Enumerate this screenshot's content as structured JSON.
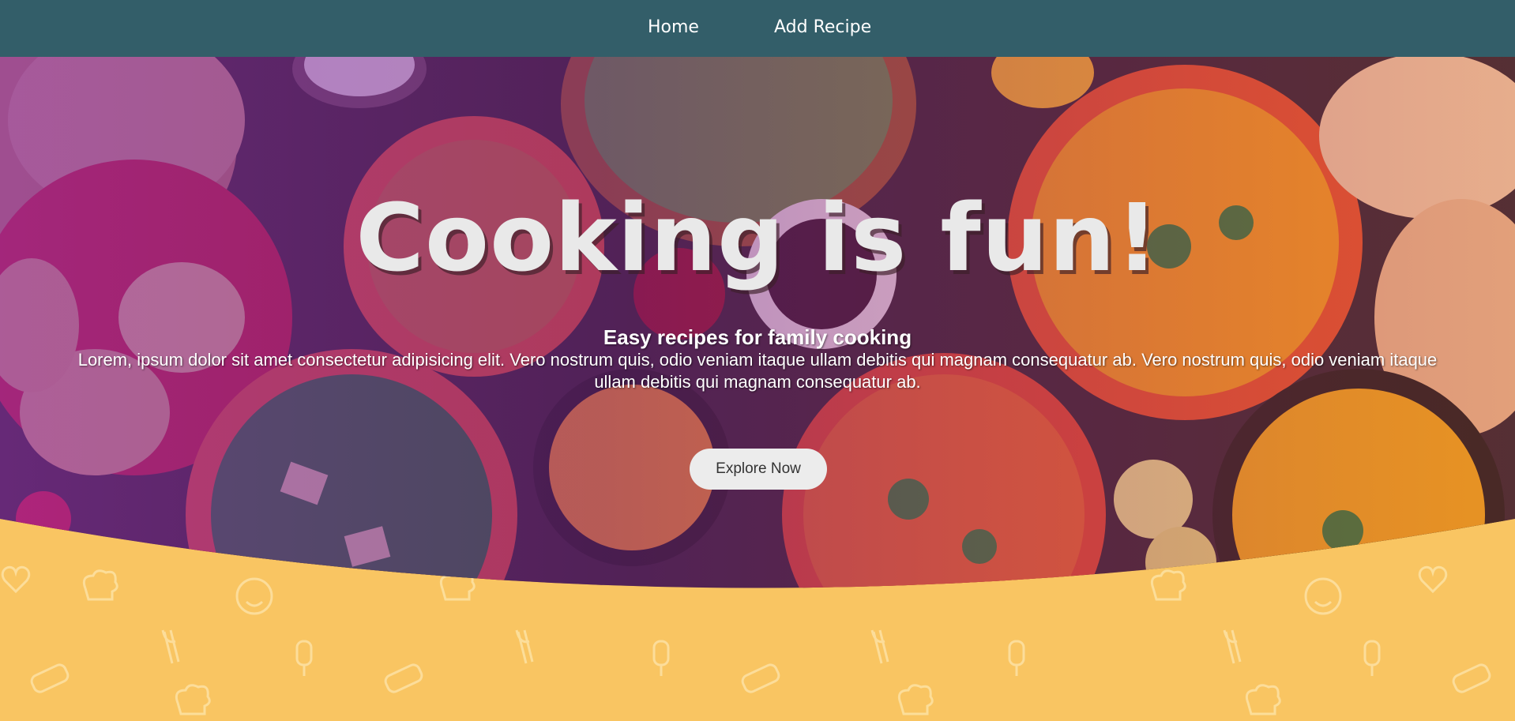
{
  "nav": {
    "home_label": "Home",
    "add_recipe_label": "Add Recipe"
  },
  "hero": {
    "title": "Cooking is fun!",
    "subtitle": "Easy recipes for family cooking",
    "description": "Lorem, ipsum dolor sit amet consectetur adipisicing elit. Vero nostrum quis, odio veniam itaque ullam debitis qui magnam consequatur ab. Vero nostrum quis, odio veniam itaque ullam debitis qui magnam consequatur ab.",
    "cta_label": "Explore Now"
  },
  "colors": {
    "nav_bg": "#335e69",
    "section_bg": "#f9c562",
    "button_bg": "#ececec"
  }
}
